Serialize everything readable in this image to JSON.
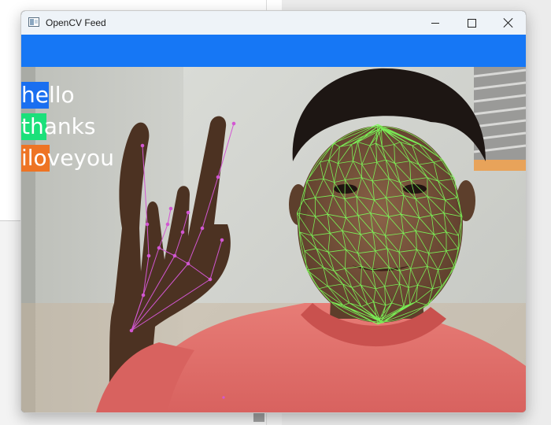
{
  "window": {
    "title": "OpenCV Feed",
    "icon": "app-icon",
    "controls": [
      "minimize-icon",
      "maximize-icon",
      "close-icon"
    ]
  },
  "header_bar": {
    "color": "#1677f5"
  },
  "predictions": [
    {
      "label": "hello",
      "color": "#1a6ff0",
      "confidence": 0.3
    },
    {
      "label": "thanks",
      "color": "#1be07a",
      "confidence": 0.25
    },
    {
      "label": "iloveyou",
      "color": "#ee7424",
      "confidence": 0.28
    }
  ],
  "landmarks": {
    "face_mesh_color": "#7dff5a",
    "hand_color": "#d257d2"
  }
}
